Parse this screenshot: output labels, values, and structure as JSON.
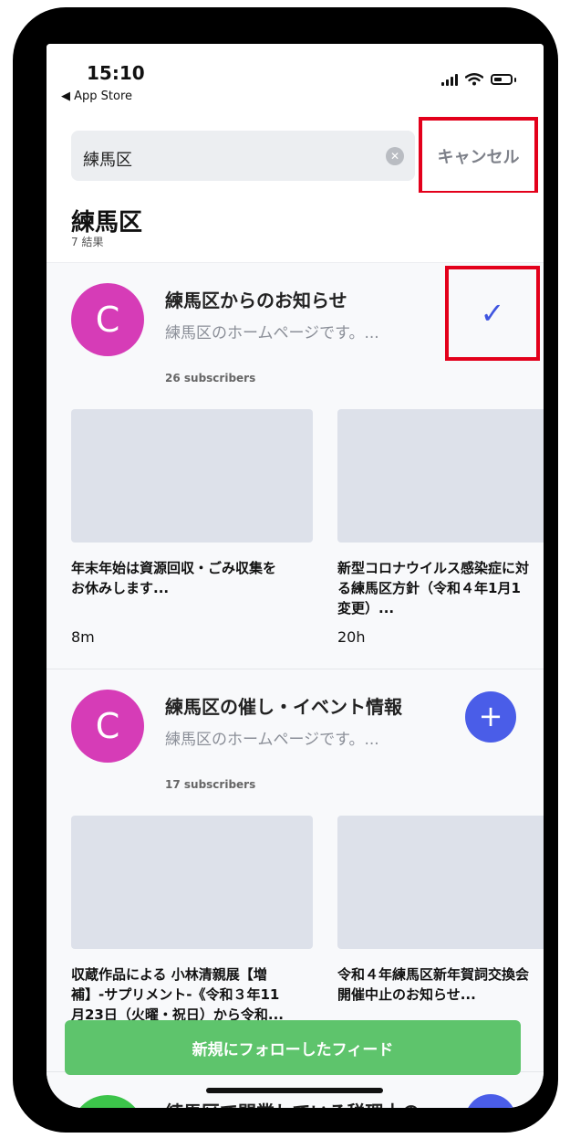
{
  "status_bar": {
    "time": "15:10",
    "back_app": "◀ App Store"
  },
  "search": {
    "query": "練馬区",
    "cancel_label": "キャンセル"
  },
  "results": {
    "title": "練馬区",
    "count": "7 結果"
  },
  "channels": [
    {
      "avatar_letter": "C",
      "title": "練馬区からのお知らせ",
      "description": "練馬区のホームページです。...",
      "subscribers": "26 subscribers",
      "follow_state": "✓",
      "posts": [
        {
          "text": "年末年始は資源回収・ごみ収集を\nお休みします...",
          "time": "8m"
        },
        {
          "text": "新型コロナウイルス感染症に対\nる練馬区方針（令和４年1月1\n変更）...",
          "time": "20h"
        }
      ]
    },
    {
      "avatar_letter": "C",
      "title": "練馬区の催し・イベント情報",
      "description": "練馬区のホームページです。...",
      "subscribers": "17 subscribers",
      "follow_state": "+",
      "posts": [
        {
          "text": "収蔵作品による 小林清親展【増\n補】-サプリメント-《令和３年11\n月23日（火曜・祝日）から令和...",
          "time": ""
        },
        {
          "text": "令和４年練馬区新年賀詞交換会\n開催中止のお知らせ...",
          "time": ""
        }
      ]
    },
    {
      "title": "練馬区で開業している税理士の..."
    }
  ],
  "footer": {
    "followed_feed_label": "新規にフォローしたフィード"
  },
  "colors": {
    "accent": "#4a5de8",
    "avatar": "#d63cb7",
    "follow_button": "#5ec46c",
    "highlight": "#e3001b"
  }
}
